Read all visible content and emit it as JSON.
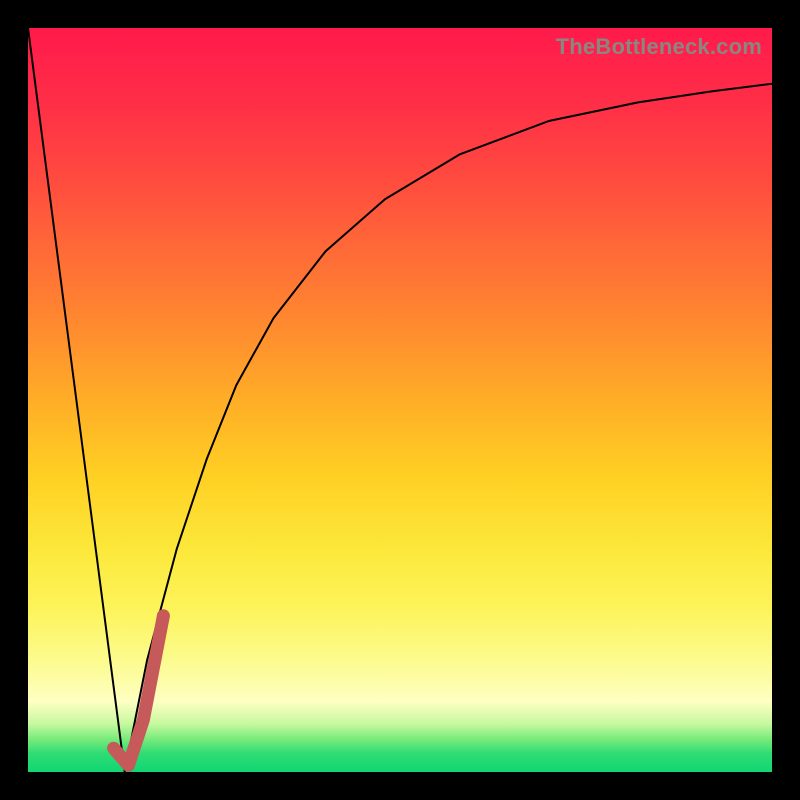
{
  "watermark": "TheBottleneck.com",
  "gradient_stops": [
    {
      "offset": 0.0,
      "color": "#ff1a4b"
    },
    {
      "offset": 0.1,
      "color": "#ff2e47"
    },
    {
      "offset": 0.2,
      "color": "#ff4a3f"
    },
    {
      "offset": 0.3,
      "color": "#ff6a37"
    },
    {
      "offset": 0.4,
      "color": "#ff8a2f"
    },
    {
      "offset": 0.5,
      "color": "#ffad27"
    },
    {
      "offset": 0.6,
      "color": "#ffcf23"
    },
    {
      "offset": 0.7,
      "color": "#fce83a"
    },
    {
      "offset": 0.78,
      "color": "#fdf45a"
    },
    {
      "offset": 0.85,
      "color": "#fcfb8e"
    },
    {
      "offset": 0.905,
      "color": "#feffc2"
    },
    {
      "offset": 0.935,
      "color": "#c7f9a0"
    },
    {
      "offset": 0.955,
      "color": "#7ceb7c"
    },
    {
      "offset": 0.975,
      "color": "#2fdc74"
    },
    {
      "offset": 1.0,
      "color": "#0fd772"
    }
  ],
  "chart_data": {
    "type": "line",
    "title": "",
    "xlabel": "",
    "ylabel": "",
    "xlim": [
      0,
      100
    ],
    "ylim": [
      0,
      100
    ],
    "series": [
      {
        "name": "left-branch",
        "x": [
          0,
          13
        ],
        "y": [
          100,
          0
        ],
        "stroke": "#000000",
        "width": 2,
        "cap": "butt"
      },
      {
        "name": "right-branch-curve",
        "x": [
          13,
          16,
          20,
          24,
          28,
          33,
          40,
          48,
          58,
          70,
          82,
          92,
          100
        ],
        "y": [
          0,
          15,
          30,
          42,
          52,
          61,
          70,
          77,
          83,
          87.5,
          90,
          91.5,
          92.5
        ],
        "stroke": "#000000",
        "width": 2,
        "cap": "butt"
      },
      {
        "name": "highlight-hook",
        "x": [
          11.5,
          13.5,
          15.5,
          18.2
        ],
        "y": [
          3.2,
          0.9,
          7,
          21
        ],
        "stroke": "#c65a5a",
        "width": 13,
        "cap": "round"
      }
    ]
  }
}
